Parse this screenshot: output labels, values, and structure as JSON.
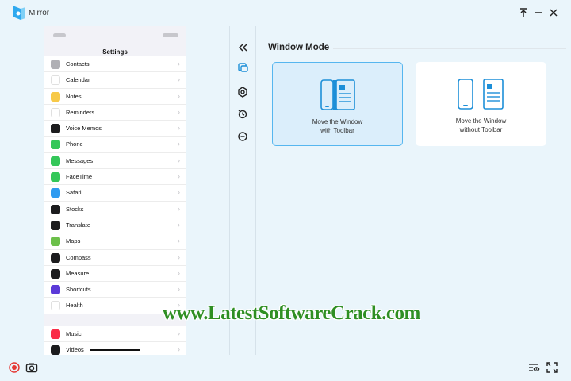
{
  "app": {
    "title": "Mirror",
    "colors": {
      "accent": "#56b6ef",
      "background": "#eaf5fb",
      "selected_card": "#dbeefb",
      "watermark": "#2f8f23"
    }
  },
  "window_controls": [
    "pin-icon",
    "minimize-icon",
    "close-icon"
  ],
  "phone": {
    "header": "Settings",
    "items": [
      {
        "label": "Contacts",
        "color": "#b0b0b5"
      },
      {
        "label": "Calendar",
        "color": "#ffffff"
      },
      {
        "label": "Notes",
        "color": "#f7c948"
      },
      {
        "label": "Reminders",
        "color": "#ffffff"
      },
      {
        "label": "Voice Memos",
        "color": "#1c1c1e"
      },
      {
        "label": "Phone",
        "color": "#34c759"
      },
      {
        "label": "Messages",
        "color": "#34c759"
      },
      {
        "label": "FaceTime",
        "color": "#34c759"
      },
      {
        "label": "Safari",
        "color": "#2f9bf0"
      },
      {
        "label": "Stocks",
        "color": "#1c1c1e"
      },
      {
        "label": "Translate",
        "color": "#1c1c1e"
      },
      {
        "label": "Maps",
        "color": "#6cc04a"
      },
      {
        "label": "Compass",
        "color": "#1c1c1e"
      },
      {
        "label": "Measure",
        "color": "#1c1c1e"
      },
      {
        "label": "Shortcuts",
        "color": "#5b3ad8"
      },
      {
        "label": "Health",
        "color": "#ffffff"
      }
    ],
    "items2": [
      {
        "label": "Music",
        "color": "#fa2d48"
      },
      {
        "label": "Videos",
        "color": "#1c1c1e"
      }
    ]
  },
  "toolbar_icons": [
    "collapse-icon",
    "window-mode-icon",
    "settings-icon",
    "history-icon",
    "remove-icon"
  ],
  "main": {
    "section_title": "Window Mode",
    "modes": [
      {
        "label_line1": "Move the Window",
        "label_line2": "with Toolbar",
        "selected": true
      },
      {
        "label_line1": "Move the Window",
        "label_line2": "without Toolbar",
        "selected": false
      }
    ]
  },
  "watermark": "www.LatestSoftwareCrack.com",
  "bottom_icons": [
    "record-icon",
    "screenshot-icon",
    "visibility-icon",
    "fullscreen-icon"
  ]
}
